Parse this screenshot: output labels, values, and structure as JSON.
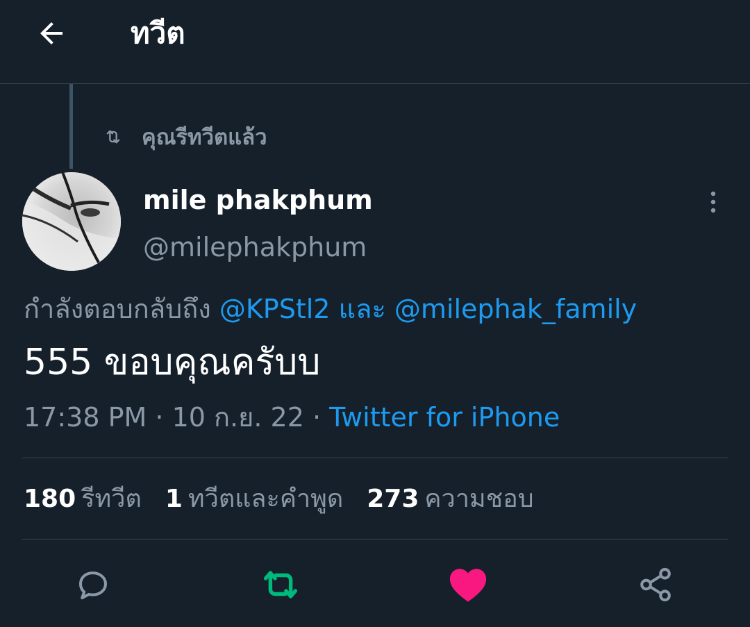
{
  "header": {
    "title": "ทวีต"
  },
  "retweet_indicator": {
    "text": "คุณรีทวีตแล้ว"
  },
  "author": {
    "name": "mile phakphum",
    "handle": "@milephakphum"
  },
  "reply_context": {
    "prefix": "กำลังตอบกลับถึง",
    "mention_1": "@KPStl2",
    "conjunction": "และ",
    "mention_2": "@milephak_family"
  },
  "tweet": {
    "text": "555 ขอบคุณครับบ"
  },
  "meta": {
    "time": "17:38 PM",
    "separator": "·",
    "date": "10 ก.ย. 22",
    "source": "Twitter for iPhone"
  },
  "stats": {
    "retweets_count": "180",
    "retweets_label": "รีทวีต",
    "quotes_count": "1",
    "quotes_label": "ทวีตและคำพูด",
    "likes_count": "273",
    "likes_label": "ความชอบ"
  },
  "actions": {
    "reply_icon": "reply-icon",
    "retweet_icon": "retweet-icon",
    "like_icon": "heart-icon",
    "share_icon": "share-icon"
  },
  "colors": {
    "background": "#15202b",
    "accent": "#1d9bf0",
    "muted": "#8b98a5",
    "retweeted": "#00ba7c",
    "liked": "#f91880"
  }
}
